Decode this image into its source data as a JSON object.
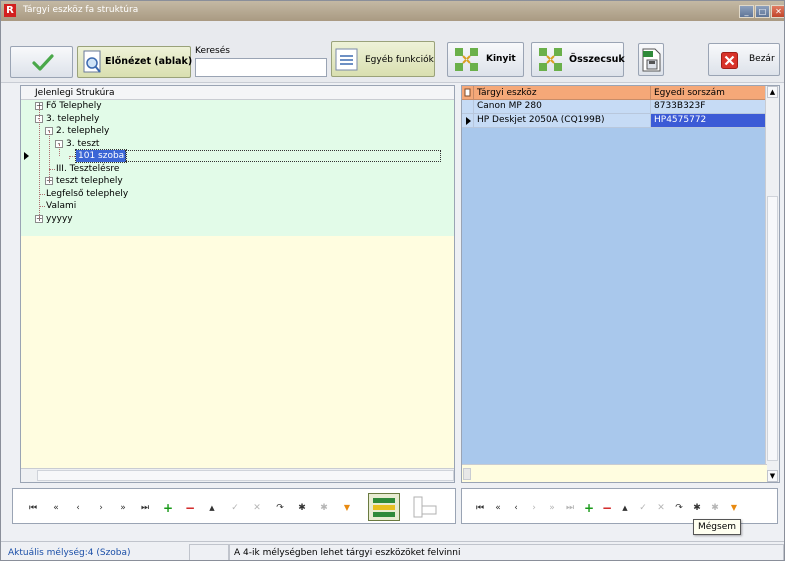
{
  "window": {
    "title": "Tárgyi eszköz fa struktúra",
    "app_icon_letter": "R",
    "minimize_glyph": "_",
    "maximize_glyph": "□",
    "close_glyph": "✕"
  },
  "toolbar": {
    "ok_icon": "checkmark-icon",
    "preview_label": "Előnézet (ablak)",
    "search_label": "Keresés",
    "search_value": "",
    "other_functions_label": "Egyéb funkciók",
    "expand_label": "Kinyit",
    "collapse_label": "Összecsuk",
    "excel_export_icon": "xls-file-icon",
    "close_label": "Bezár"
  },
  "tree": {
    "header": "Jelenlegi Strukúra",
    "selected_index": 4,
    "items": [
      {
        "label": "Fő Telephely",
        "level": 0,
        "expander": "+"
      },
      {
        "label": "3. telephely",
        "level": 0,
        "expander": "-"
      },
      {
        "label": "2. telephely",
        "level": 1,
        "expander": "-"
      },
      {
        "label": "3. teszt",
        "level": 2,
        "expander": "-"
      },
      {
        "label": "101 szoba",
        "level": 3,
        "expander": ""
      },
      {
        "label": "III. Tesztelésre",
        "level": 1,
        "expander": ""
      },
      {
        "label": "teszt telephely",
        "level": 1,
        "expander": "+"
      },
      {
        "label": "Legfelső telephely",
        "level": 0,
        "expander": ""
      },
      {
        "label": "Valami",
        "level": 0,
        "expander": ""
      },
      {
        "label": "yyyyy",
        "level": 0,
        "expander": "+"
      }
    ]
  },
  "grid": {
    "columns": [
      "Tárgyi eszköz",
      "Egyedi sorszám"
    ],
    "rows": [
      {
        "asset": "Canon MP 280",
        "serial": "8733B323F"
      },
      {
        "asset": "HP Deskjet 2050A (CQ199B)",
        "serial": "HP4575772"
      }
    ],
    "current_row": 1
  },
  "navigator": {
    "first": "⏮",
    "prev_page": "«",
    "prev": "‹",
    "next": "›",
    "next_page": "»",
    "last": "⏭",
    "add": "+",
    "delete": "−",
    "up": "▲",
    "post": "✓",
    "cancel": "✕",
    "refresh": "↷",
    "apply": "✱",
    "clear": "✱",
    "filter": "▼"
  },
  "tooltip": "Mégsem",
  "status": {
    "depth": "Aktuális mélység:4 (Szoba)",
    "middle": "",
    "message": "A 4-ik mélységben lehet tárgyi eszközöket felvinni"
  },
  "colors": {
    "tree_bg": "#e2fbe8",
    "panel_bg": "#fffde0",
    "grid_bg": "#a9c8ec",
    "grid_header": "#f5a878",
    "selection": "#3b66d6"
  }
}
